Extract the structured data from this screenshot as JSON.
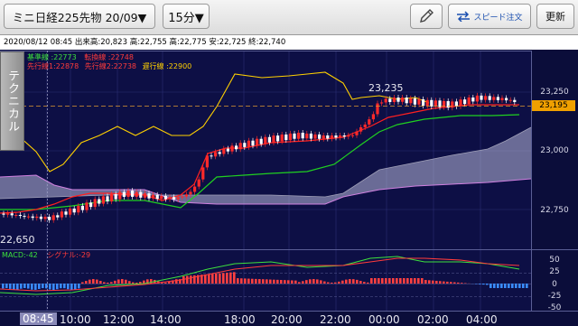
{
  "toolbar": {
    "symbol": "ミニ日経225先物 20/09▼",
    "interval": "15分▼",
    "speed_order": "スピード注文",
    "refresh": "更新"
  },
  "info": {
    "text": "2020/08/12 08:45 出来高:20,823 高:22,755 高:22,775 安:22,725 終:22,740"
  },
  "side_tab": "テクニカル",
  "legend": {
    "line1": [
      {
        "text": "基準線 :22773",
        "color": "#3de03d"
      },
      {
        "text": "転換線 :22748",
        "color": "#ff3b3b"
      }
    ],
    "line2": [
      {
        "text": "先行線1:22878",
        "color": "#ff3b3b"
      },
      {
        "text": "先行線2:22738",
        "color": "#ff3b3b"
      },
      {
        "text": "遅行線 :22900",
        "color": "#ffd000"
      }
    ],
    "macd": [
      {
        "text": "MACD:-42",
        "color": "#3de03d"
      },
      {
        "text": "シグナル:-29",
        "color": "#ff3b3b"
      }
    ]
  },
  "price_axis": {
    "labels": [
      "23,250",
      "23,000",
      "22,750"
    ],
    "current": "23,195"
  },
  "macd_axis": {
    "labels": [
      "50",
      "25",
      "0",
      "-25",
      "-50"
    ]
  },
  "annotations": {
    "high": "23,235",
    "low": "22,650"
  },
  "time_axis": {
    "cursor": "08:45",
    "labels": [
      "10:00",
      "12:00",
      "14:00",
      "18:00",
      "20:00",
      "22:00",
      "00:00",
      "02:00",
      "04:00"
    ]
  },
  "colors": {
    "background": "#0b0d3a",
    "tenkan": "#ff2020",
    "kijun": "#20d020",
    "chikou": "#ffd000",
    "cloud": "#b8b8d8",
    "macd": "#3de03d",
    "signal": "#ff3b3b"
  }
}
